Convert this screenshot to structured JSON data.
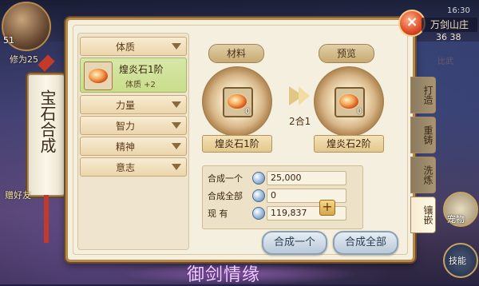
{
  "hud": {
    "level": "51",
    "power": "修为25",
    "map_name": "万剑山庄",
    "coords": "36 38",
    "clock": "16:30",
    "left_button": "赠好友",
    "faded_top_right": "比武"
  },
  "title": "宝石合成",
  "attributes": {
    "categories": [
      {
        "label": "体质"
      },
      {
        "label": "力量"
      },
      {
        "label": "智力"
      },
      {
        "label": "精神"
      },
      {
        "label": "意志"
      }
    ],
    "selected_item": {
      "name": "煌炎石1阶",
      "stat": "体质 +2"
    }
  },
  "synthesis": {
    "material_label": "材料",
    "preview_label": "预览",
    "material_name": "煌炎石1阶",
    "preview_name": "煌炎石2阶",
    "material_qty": "0",
    "preview_qty": "0",
    "ratio": "2合1"
  },
  "costs": {
    "one_label": "合成一个",
    "one_value": "25,000",
    "all_label": "合成全部",
    "all_value": "0",
    "have_label": "现    有",
    "have_value": "119,837"
  },
  "buttons": {
    "merge_one": "合成一个",
    "merge_all": "合成全部",
    "close": "×",
    "add": "+"
  },
  "tabs": [
    {
      "label": "打造"
    },
    {
      "label": "重铸"
    },
    {
      "label": "洗炼"
    },
    {
      "label": "镶嵌"
    }
  ],
  "side_buttons": {
    "pet": "宠物",
    "skill": "技能"
  },
  "logo": "御剑情缘",
  "colors": {
    "panel_bg": "#f5efdf",
    "border_gold": "#b58a4a",
    "selected_green": "#c9dd8c",
    "button_blue": "#b9c9d8"
  }
}
